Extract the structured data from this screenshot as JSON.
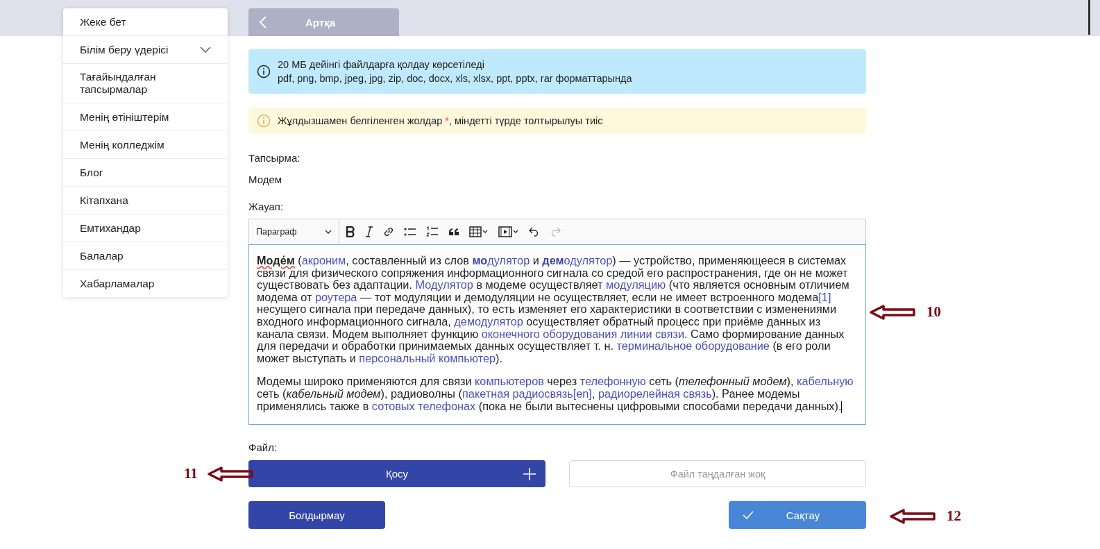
{
  "sidebar": {
    "items": [
      {
        "label": "Жеке бет",
        "kind": "link"
      },
      {
        "label": "Білім беру үдерісі",
        "kind": "group"
      },
      {
        "label": "Тағайындалған тапсырмалар",
        "kind": "link"
      },
      {
        "label": "Менің өтініштерім",
        "kind": "link"
      },
      {
        "label": "Менің колледжім",
        "kind": "link"
      },
      {
        "label": "Блог",
        "kind": "link"
      },
      {
        "label": "Кітапхана",
        "kind": "link"
      },
      {
        "label": "Емтихандар",
        "kind": "link"
      },
      {
        "label": "Балалар",
        "kind": "link"
      },
      {
        "label": "Хабарламалар",
        "kind": "link"
      }
    ]
  },
  "back_button": {
    "label": "Артқа"
  },
  "info_notice": {
    "lines": [
      "20 МБ дейінгі файлдарға қолдау көрсетіледі",
      "pdf, png, bmp, jpeg, jpg, zip, doc, docx, xls, xlsx, ppt, pptx, rar форматтарында"
    ]
  },
  "warning_notice": {
    "before": "Жұлдызшамен белгіленген жолдар ",
    "mark": "*",
    "after": ", міндетті түрде толтырылуы тиіс"
  },
  "task": {
    "label": "Тапсырма:",
    "value": "Модем"
  },
  "answer": {
    "label": "Жауап:",
    "format": "Параграф",
    "paragraphs": [
      [
        {
          "kind": "bold",
          "text": "Моде́м"
        },
        {
          "kind": "text",
          "text": " ("
        },
        {
          "kind": "link",
          "text": "акроним"
        },
        {
          "kind": "text",
          "text": ", составленный из слов "
        },
        {
          "kind": "link-bold",
          "text": "мо"
        },
        {
          "kind": "link",
          "text": "дулятор"
        },
        {
          "kind": "text",
          "text": " и "
        },
        {
          "kind": "link-bold",
          "text": "дем"
        },
        {
          "kind": "link",
          "text": "одулятор"
        },
        {
          "kind": "text",
          "text": ") — устройство, применяющееся в системах связи для физического сопряжения информационного сигнала со средой его распространения, где он не может существовать без адаптации. "
        },
        {
          "kind": "link",
          "text": "Модулятор"
        },
        {
          "kind": "text",
          "text": " в модеме осуществляет "
        },
        {
          "kind": "link",
          "text": "модуляцию"
        },
        {
          "kind": "text",
          "text": " (что является основным отличием модема от "
        },
        {
          "kind": "link",
          "text": "роутера"
        },
        {
          "kind": "text",
          "text": " — тот модуляции и демодуляции не осуществляет, если не имеет встроенного модема"
        },
        {
          "kind": "link",
          "text": "[1]"
        },
        {
          "kind": "text",
          "text": " несущего сигнала при передаче данных), то есть изменяет его характеристики в соответствии с изменениями входного информационного сигнала, "
        },
        {
          "kind": "link",
          "text": "демодулятор"
        },
        {
          "kind": "text",
          "text": " осуществляет обратный процесс при приёме данных из канала связи. Модем выполняет функцию "
        },
        {
          "kind": "link",
          "text": "оконечного оборудования линии связи"
        },
        {
          "kind": "text",
          "text": ". Само формирование данных для передачи и обработки принимаемых данных осуществляет т. н. "
        },
        {
          "kind": "link",
          "text": "терминальное оборудование"
        },
        {
          "kind": "text",
          "text": " (в его роли может выступать и "
        },
        {
          "kind": "link",
          "text": "персональный компьютер"
        },
        {
          "kind": "text",
          "text": ")."
        }
      ],
      [
        {
          "kind": "text",
          "text": "Модемы широко применяются для связи "
        },
        {
          "kind": "link",
          "text": "компьютеров"
        },
        {
          "kind": "text",
          "text": " через "
        },
        {
          "kind": "link",
          "text": "телефонную"
        },
        {
          "kind": "text",
          "text": " сеть ("
        },
        {
          "kind": "italic",
          "text": "телефонный модем"
        },
        {
          "kind": "text",
          "text": "), "
        },
        {
          "kind": "link",
          "text": "кабельную"
        },
        {
          "kind": "text",
          "text": " сеть ("
        },
        {
          "kind": "italic",
          "text": "кабельный модем"
        },
        {
          "kind": "text",
          "text": "), радиоволны ("
        },
        {
          "kind": "link",
          "text": "пакетная радиосвязь"
        },
        {
          "kind": "link",
          "text": "[en]"
        },
        {
          "kind": "text",
          "text": ", "
        },
        {
          "kind": "link",
          "text": "радиорелейная связь"
        },
        {
          "kind": "text",
          "text": "). Ранее модемы применялись также в "
        },
        {
          "kind": "link",
          "text": "сотовых телефонах"
        },
        {
          "kind": "text",
          "text": " (пока не были вытеснены цифровыми способами передачи данных)."
        }
      ]
    ]
  },
  "file": {
    "label": "Файл:",
    "add_button": "Қосу",
    "status": "Файл таңдалған жоқ"
  },
  "cancel_button": "Болдырмау",
  "save_button": "Сақтау",
  "annotations": [
    {
      "label": "10",
      "kind": "editor"
    },
    {
      "label": "11",
      "kind": "add"
    },
    {
      "label": "12",
      "kind": "save"
    }
  ]
}
